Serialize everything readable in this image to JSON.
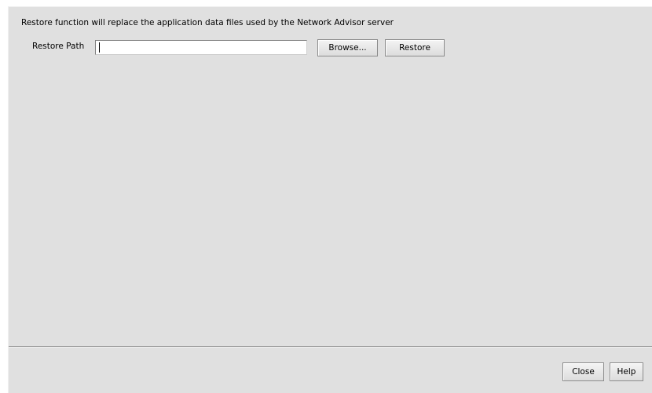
{
  "dialog": {
    "info_text": "Restore function will replace the application data files used by the Network Advisor server",
    "restore_path": {
      "label": "Restore Path",
      "value": "",
      "placeholder": ""
    },
    "buttons": {
      "browse_label": "Browse...",
      "restore_label": "Restore",
      "close_label": "Close",
      "help_label": "Help"
    }
  },
  "colors": {
    "panel_background": "#e0e0e0",
    "divider": "#8c8c8c"
  }
}
